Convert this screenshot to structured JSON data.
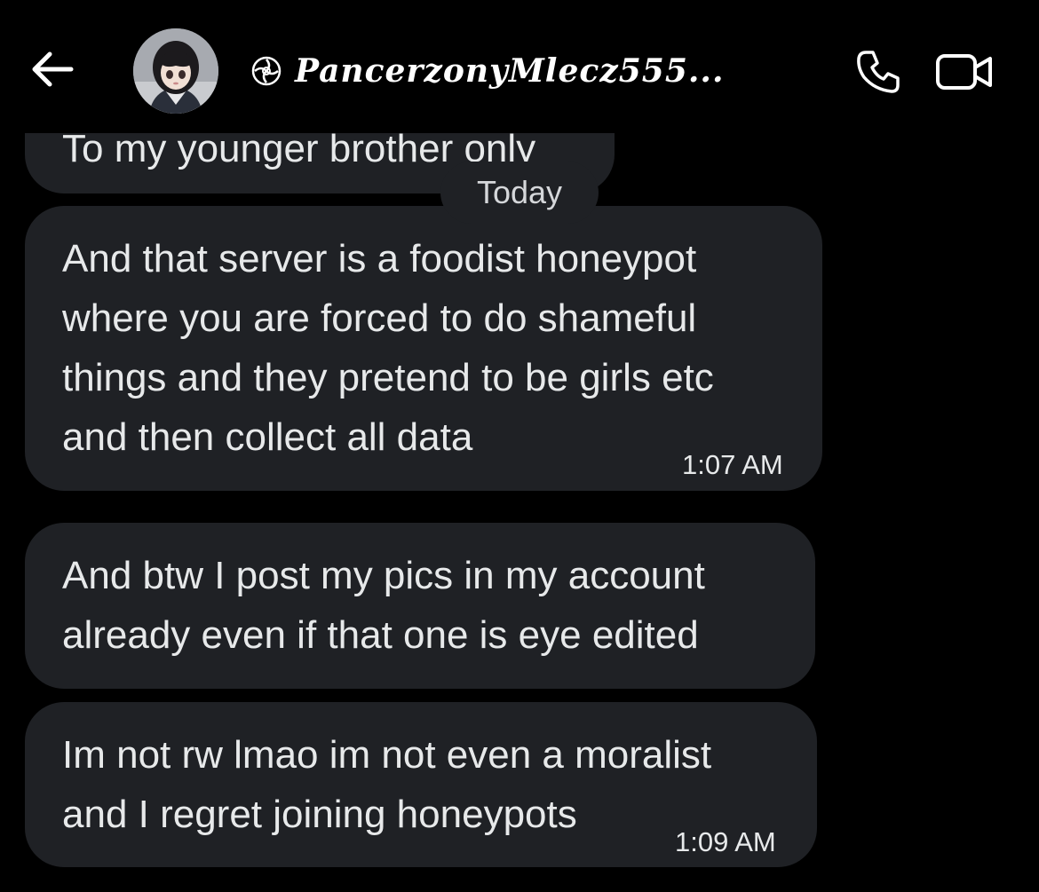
{
  "header": {
    "contact_name": "PancerzonyMlecz555...",
    "back_icon": "arrow-left-icon",
    "verified_icon": "spiral-badge-icon",
    "call_icon": "phone-icon",
    "video_icon": "video-camera-icon"
  },
  "messages": {
    "previous": {
      "text": "To my younger brother only"
    },
    "date_separator": "Today",
    "items": [
      {
        "text": "And that server is a foodist honeypot\nwhere you are forced to do shameful\nthings and they pretend to be girls etc\nand then collect all data",
        "time": "1:07 AM"
      },
      {
        "text": "And btw I post my pics in my account\nalready even if that one is eye edited",
        "time": ""
      },
      {
        "text": "Im not rw lmao im not even a moralist\nand I regret joining honeypots",
        "time": "1:09 AM"
      }
    ]
  },
  "colors": {
    "background": "#000000",
    "bubble": "#1f2125",
    "text": "#e7e9ea"
  }
}
